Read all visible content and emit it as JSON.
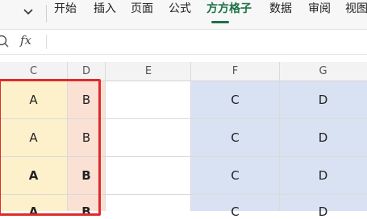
{
  "ribbon": {
    "tabs": [
      {
        "label": "开始",
        "active": false
      },
      {
        "label": "插入",
        "active": false
      },
      {
        "label": "页面",
        "active": false
      },
      {
        "label": "公式",
        "active": false
      },
      {
        "label": "方方格子",
        "active": true
      },
      {
        "label": "数据",
        "active": false
      },
      {
        "label": "审阅",
        "active": false
      },
      {
        "label": "视图",
        "active": false
      }
    ],
    "accent_color": "#1e7145"
  },
  "formula_bar": {
    "fx_label": "fx",
    "value": ""
  },
  "columns": [
    "C",
    "D",
    "E",
    "F",
    "G"
  ],
  "grid": {
    "rows": [
      [
        "A",
        "B",
        "",
        "C",
        "D"
      ],
      [
        "A",
        "B",
        "",
        "C",
        "D"
      ],
      [
        "A",
        "B",
        "",
        "C",
        "D"
      ],
      [
        "A",
        "B",
        "",
        "C",
        "D"
      ]
    ],
    "bold_rows": [
      2,
      3
    ],
    "colors": {
      "col_c_fill": "#fdf1cc",
      "col_d_fill": "#fbe1d4",
      "col_fg_fill": "#d9e2f3",
      "selection_border": "#e02b2b"
    }
  }
}
